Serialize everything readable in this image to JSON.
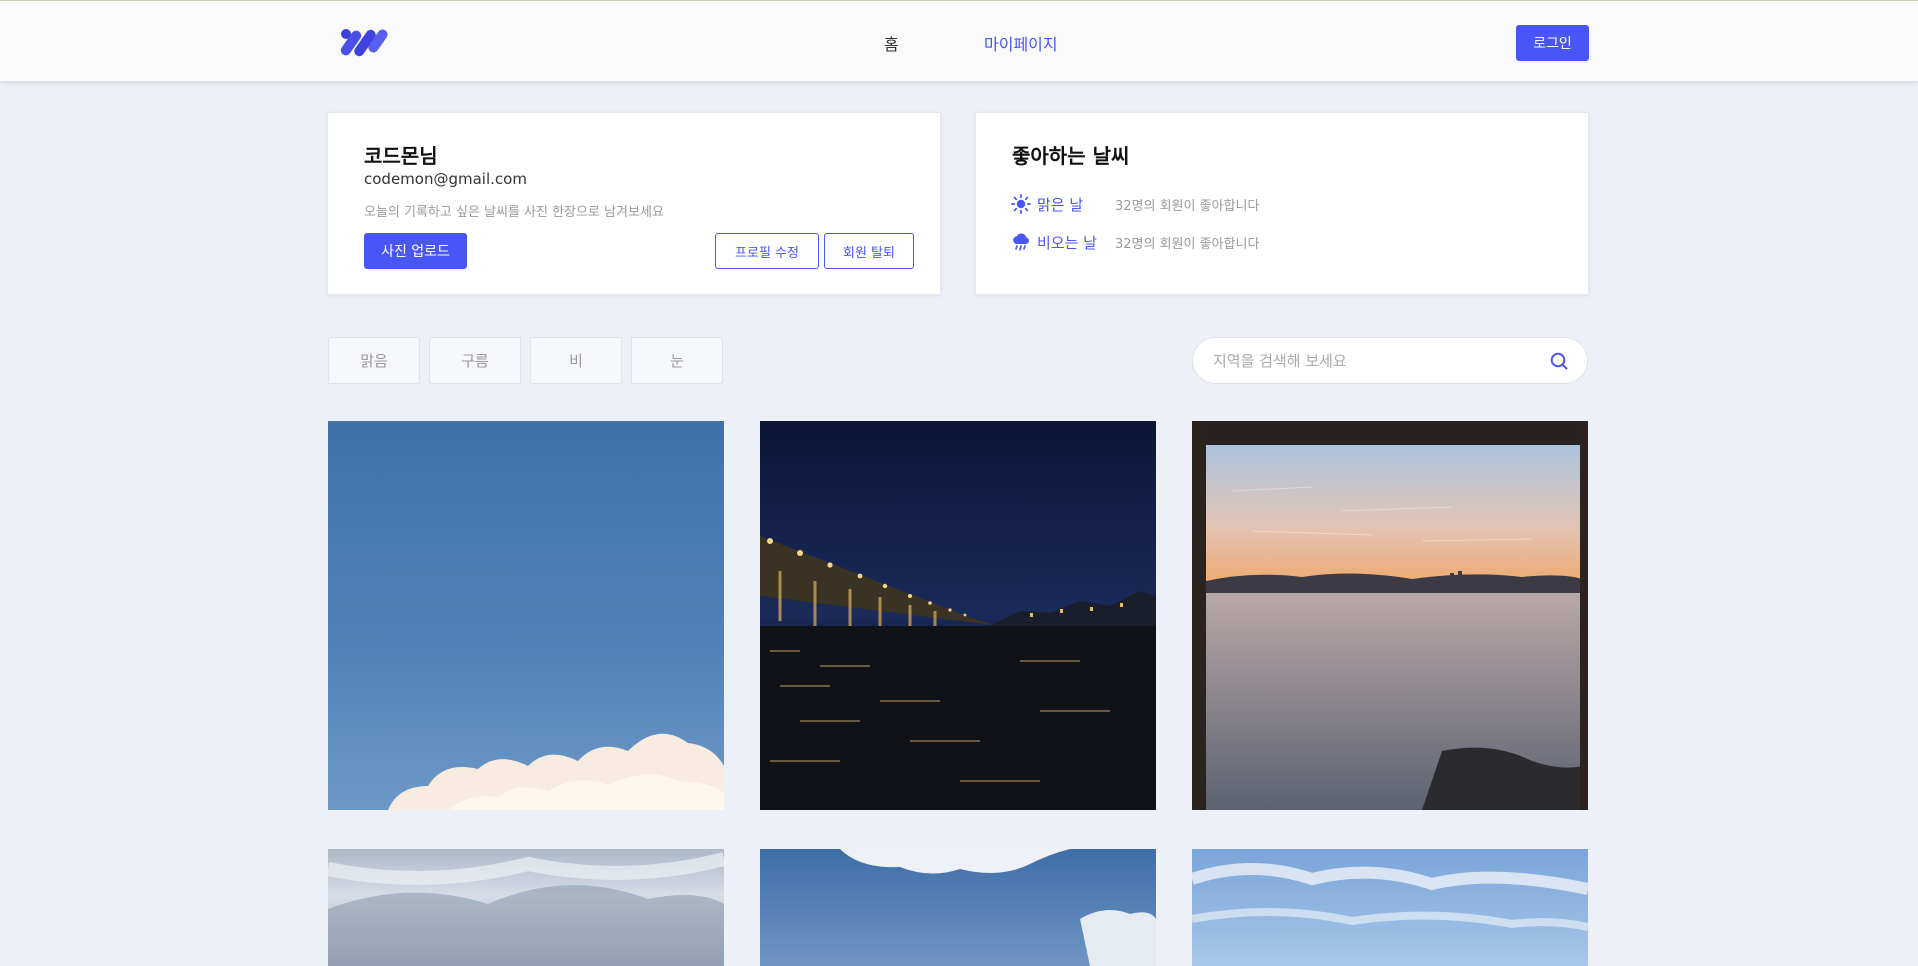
{
  "header": {
    "logo": "logo-icon",
    "nav": {
      "home": "홈",
      "mypage": "마이페이지"
    },
    "login_label": "로그인",
    "accent_color": "#4a55f5"
  },
  "profile": {
    "name": "코드몬님",
    "email": "codemon@gmail.com",
    "description": "오늘의 기록하고 싶은 날씨를 사진 한장으로 남겨보세요",
    "upload_label": "사진 업로드",
    "edit_label": "프로필 수정",
    "withdraw_label": "회원 탈퇴"
  },
  "favorite_weather": {
    "title": "좋아하는 날씨",
    "items": [
      {
        "icon": "sun-icon",
        "label": "맑은 날",
        "count_text": "32명의 회원이 좋아합니다"
      },
      {
        "icon": "rain-cloud-icon",
        "label": "비오는 날",
        "count_text": "32명의 회원이 좋아합니다"
      }
    ]
  },
  "filters": [
    "맑음",
    "구름",
    "비",
    "눈"
  ],
  "search": {
    "placeholder": "지역을 검색해 보세요",
    "value": "",
    "icon": "search-icon"
  }
}
